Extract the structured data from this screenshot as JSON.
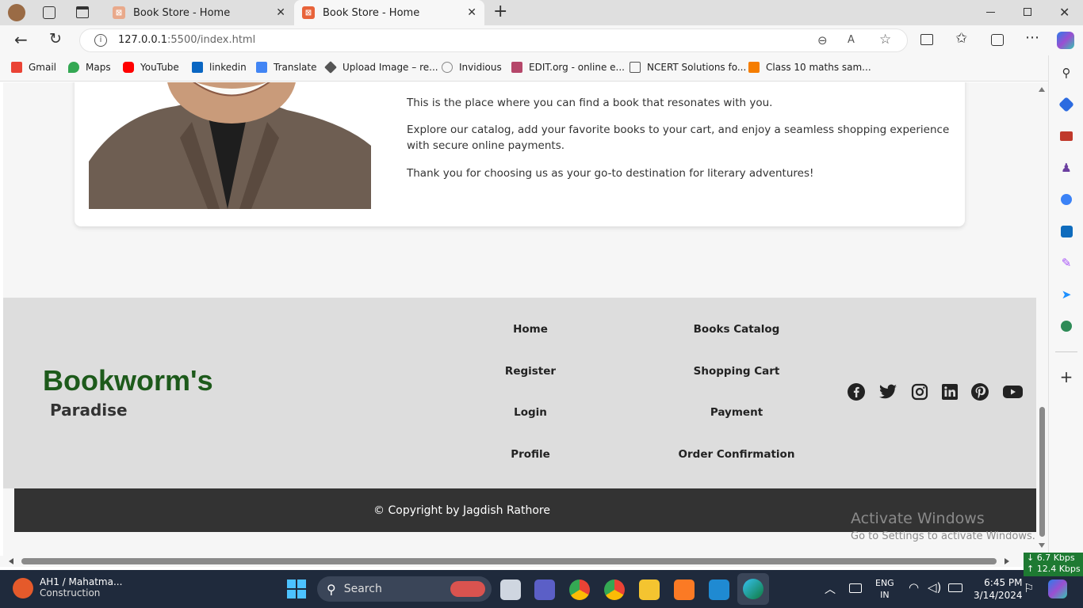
{
  "browser": {
    "tabs": [
      {
        "title": "Book Store - Home",
        "active": false
      },
      {
        "title": "Book Store - Home",
        "active": true
      }
    ],
    "new_tab_label": "+",
    "url_host": "127.0.0.1",
    "url_rest": ":5500/index.html",
    "bookmarks": [
      {
        "label": "Gmail",
        "icon": "gmail-icon",
        "color": "#ea4335"
      },
      {
        "label": "Maps",
        "icon": "maps-icon",
        "color": "#34a853"
      },
      {
        "label": "YouTube",
        "icon": "youtube-icon",
        "color": "#ff0000"
      },
      {
        "label": "linkedin",
        "icon": "linkedin-icon",
        "color": "#0a66c2"
      },
      {
        "label": "Translate",
        "icon": "translate-icon",
        "color": "#4285f4"
      },
      {
        "label": "Upload Image – re...",
        "icon": "upload-icon",
        "color": "#555555"
      },
      {
        "label": "Invidious",
        "icon": "invidious-icon",
        "color": "#888888"
      },
      {
        "label": "EDIT.org - online e...",
        "icon": "edit-icon",
        "color": "#b5476a"
      },
      {
        "label": "NCERT Solutions fo...",
        "icon": "page-icon",
        "color": "#666666"
      },
      {
        "label": "Class 10 maths sam...",
        "icon": "blogger-icon",
        "color": "#f57d00"
      }
    ]
  },
  "about": {
    "para1": "This is the place where you can find a book that resonates with you.",
    "para2": "Explore our catalog, add your favorite books to your cart, and enjoy a seamless shopping experience with secure online payments.",
    "para3": "Thank you for choosing us as your go-to destination for literary adventures!"
  },
  "footer": {
    "brand_line1": "Bookworm's",
    "brand_line2": "Paradise",
    "links_col1": [
      "Home",
      "Register",
      "Login",
      "Profile"
    ],
    "links_col2": [
      "Books Catalog",
      "Shopping Cart",
      "Payment",
      "Order Confirmation"
    ],
    "social": [
      "facebook-icon",
      "twitter-icon",
      "instagram-icon",
      "linkedin-icon",
      "pinterest-icon",
      "youtube-icon"
    ],
    "copyright": "© Copyright by Jagdish Rathore",
    "brand_color": "#1d5a1b"
  },
  "watermark": {
    "title": "Activate Windows",
    "subtitle": "Go to Settings to activate Windows."
  },
  "network": {
    "down": "6.7 Kbps",
    "up": "12.4 Kbps"
  },
  "taskbar": {
    "weather_title": "AH1 / Mahatma...",
    "weather_sub": "Construction",
    "search_placeholder": "Search",
    "lang1": "ENG",
    "lang2": "IN",
    "time": "6:45 PM",
    "date": "3/14/2024"
  }
}
